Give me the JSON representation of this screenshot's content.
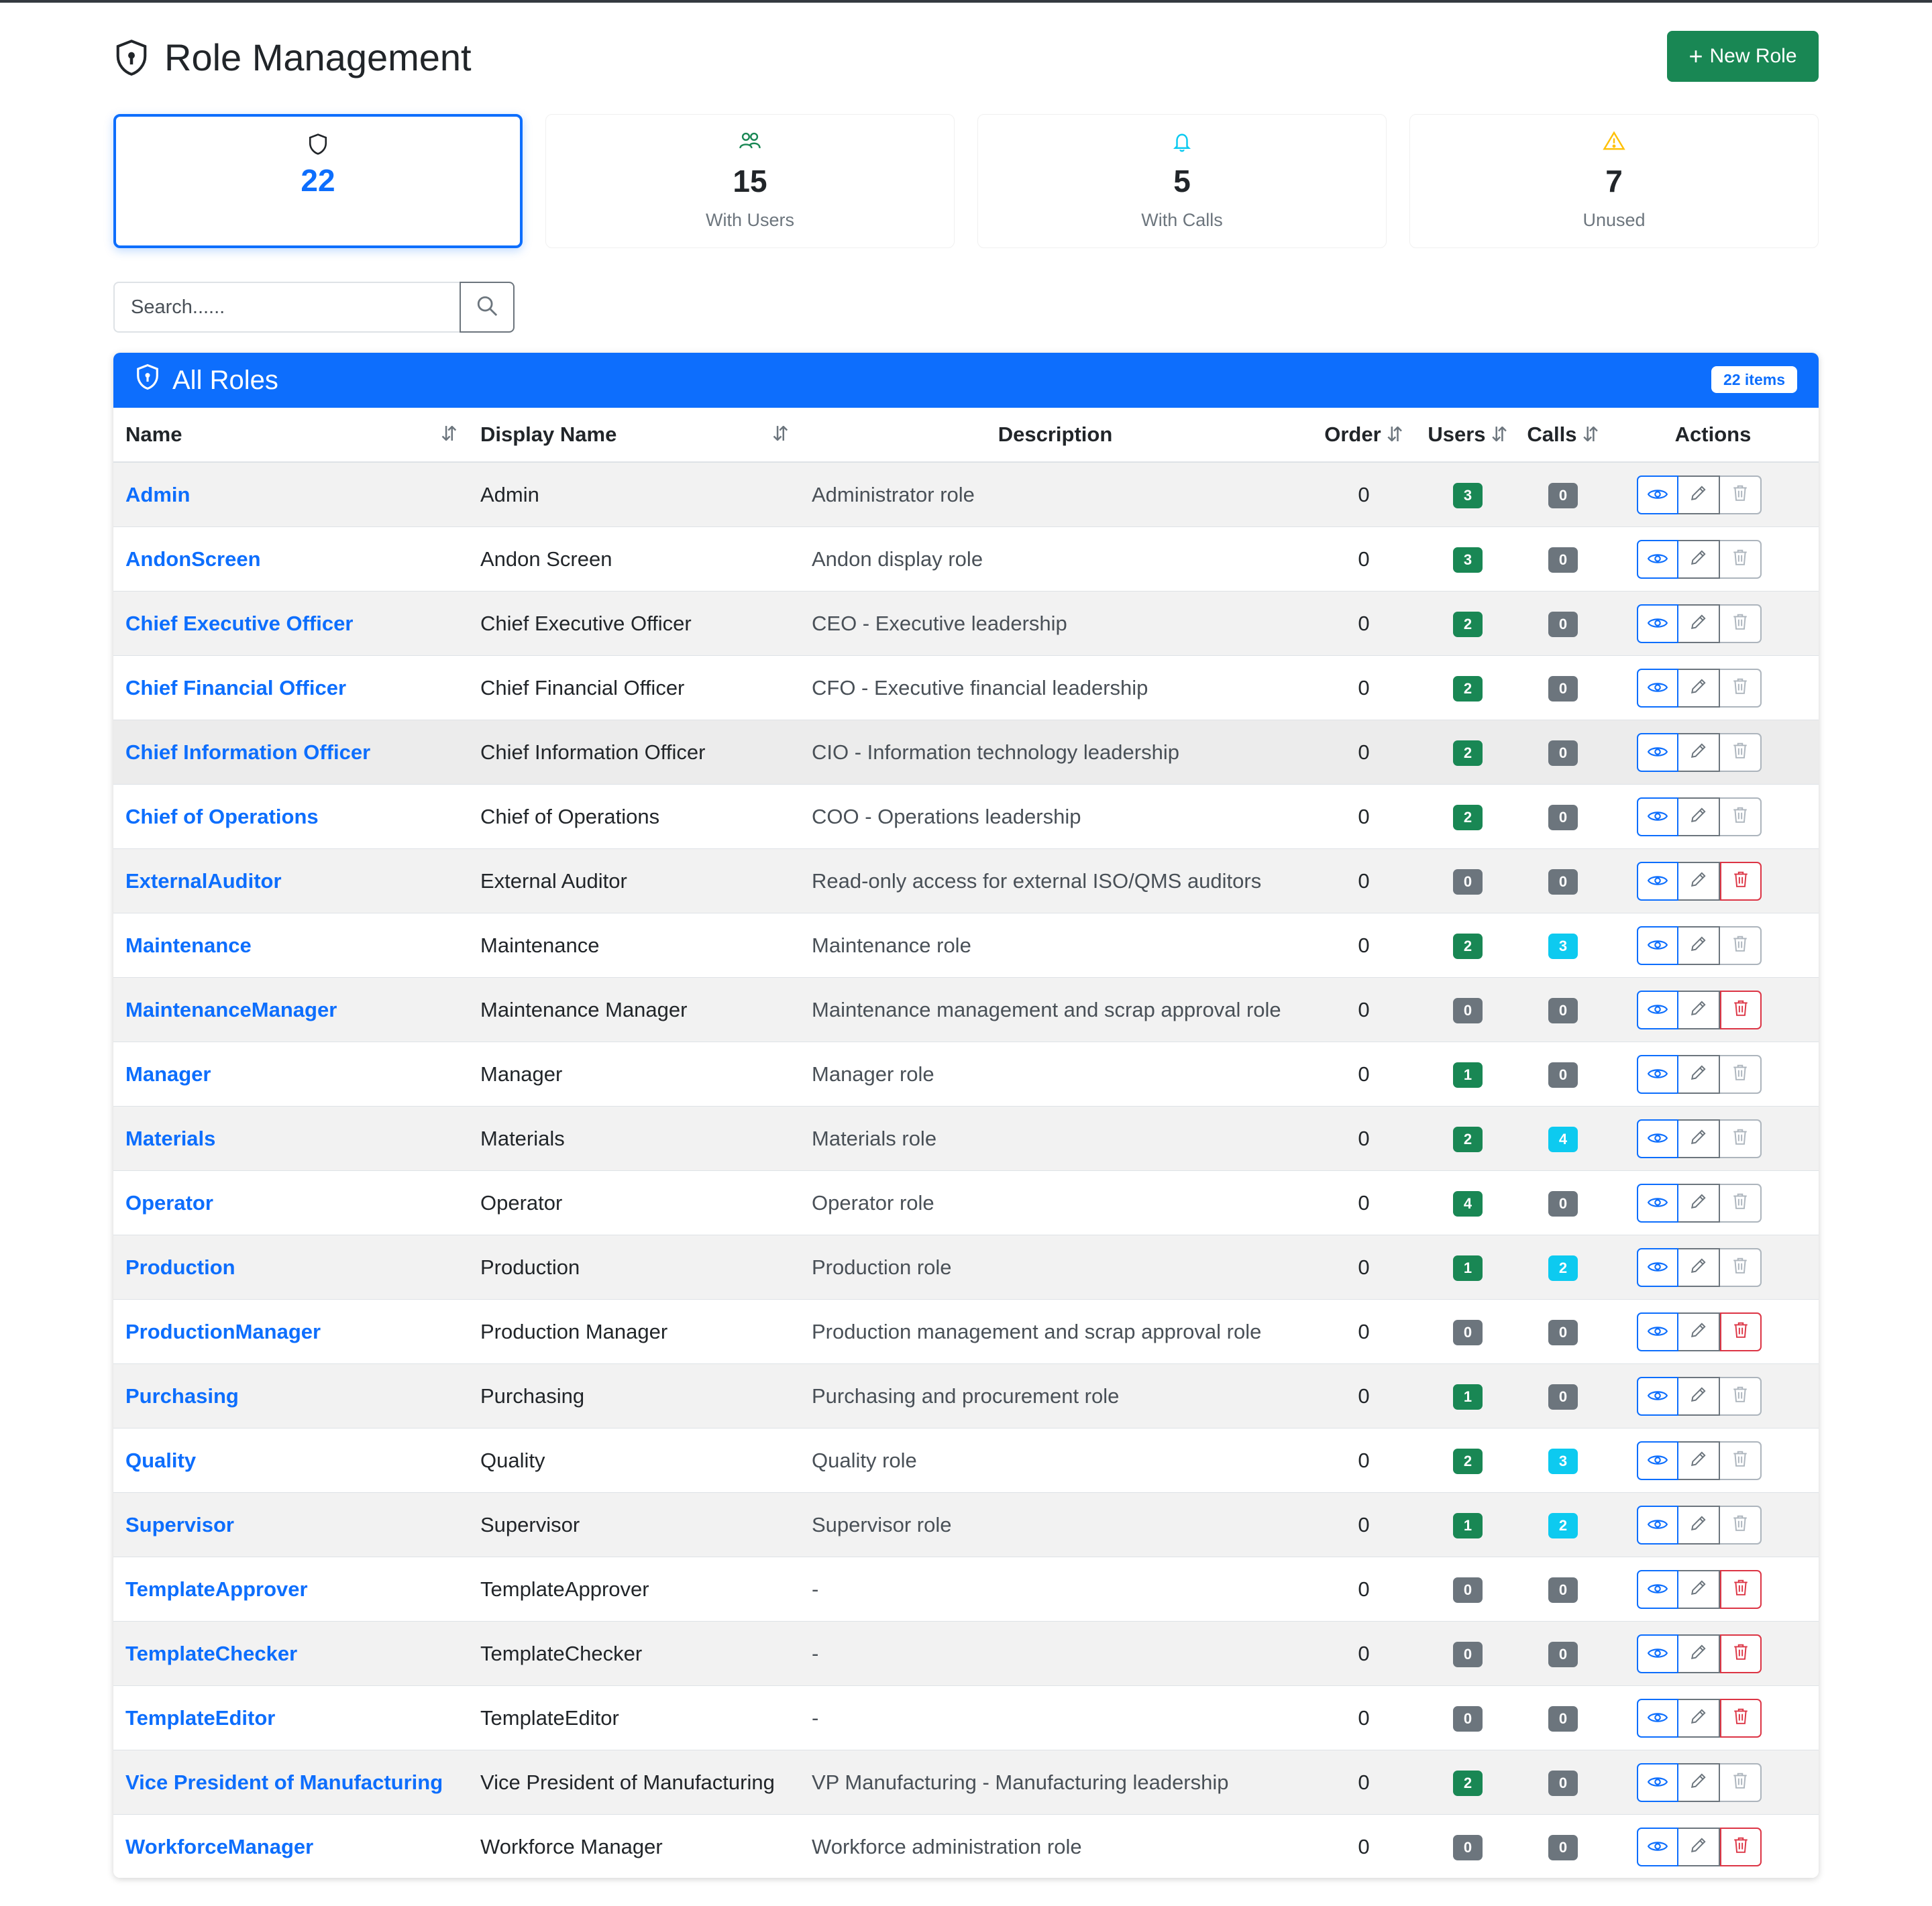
{
  "header": {
    "title": "Role Management",
    "new_role_label": "New Role"
  },
  "stats": [
    {
      "value": "22",
      "label": "",
      "icon": "shield-icon"
    },
    {
      "value": "15",
      "label": "With Users",
      "icon": "people-icon"
    },
    {
      "value": "5",
      "label": "With Calls",
      "icon": "bell-icon"
    },
    {
      "value": "7",
      "label": "Unused",
      "icon": "warning-triangle-icon"
    }
  ],
  "search": {
    "placeholder": "Search......",
    "value": ""
  },
  "panel": {
    "title": "All Roles",
    "count_label": "22 items"
  },
  "columns": {
    "name": "Name",
    "display_name": "Display Name",
    "description": "Description",
    "order": "Order",
    "users": "Users",
    "calls": "Calls",
    "actions": "Actions",
    "sort_glyph": "⇵"
  },
  "colors": {
    "primary": "#0d6efd",
    "success": "#198754",
    "secondary": "#6c757d",
    "info": "#0dcaf0",
    "danger": "#dc3545"
  },
  "roles": [
    {
      "name": "Admin",
      "display": "Admin",
      "desc": "Administrator role",
      "order": "0",
      "users": "3",
      "calls": "0",
      "deletable": false
    },
    {
      "name": "AndonScreen",
      "display": "Andon Screen",
      "desc": "Andon display role",
      "order": "0",
      "users": "3",
      "calls": "0",
      "deletable": false
    },
    {
      "name": "Chief Executive Officer",
      "display": "Chief Executive Officer",
      "desc": "CEO - Executive leadership",
      "order": "0",
      "users": "2",
      "calls": "0",
      "deletable": false
    },
    {
      "name": "Chief Financial Officer",
      "display": "Chief Financial Officer",
      "desc": "CFO - Executive financial leadership",
      "order": "0",
      "users": "2",
      "calls": "0",
      "deletable": false
    },
    {
      "name": "Chief Information Officer",
      "display": "Chief Information Officer",
      "desc": "CIO - Information technology leadership",
      "order": "0",
      "users": "2",
      "calls": "0",
      "deletable": false
    },
    {
      "name": "Chief of Operations",
      "display": "Chief of Operations",
      "desc": "COO - Operations leadership",
      "order": "0",
      "users": "2",
      "calls": "0",
      "deletable": false
    },
    {
      "name": "ExternalAuditor",
      "display": "External Auditor",
      "desc": "Read-only access for external ISO/QMS auditors",
      "order": "0",
      "users": "0",
      "calls": "0",
      "deletable": true
    },
    {
      "name": "Maintenance",
      "display": "Maintenance",
      "desc": "Maintenance role",
      "order": "0",
      "users": "2",
      "calls": "3",
      "deletable": false
    },
    {
      "name": "MaintenanceManager",
      "display": "Maintenance Manager",
      "desc": "Maintenance management and scrap approval role",
      "order": "0",
      "users": "0",
      "calls": "0",
      "deletable": true
    },
    {
      "name": "Manager",
      "display": "Manager",
      "desc": "Manager role",
      "order": "0",
      "users": "1",
      "calls": "0",
      "deletable": false
    },
    {
      "name": "Materials",
      "display": "Materials",
      "desc": "Materials role",
      "order": "0",
      "users": "2",
      "calls": "4",
      "deletable": false
    },
    {
      "name": "Operator",
      "display": "Operator",
      "desc": "Operator role",
      "order": "0",
      "users": "4",
      "calls": "0",
      "deletable": false
    },
    {
      "name": "Production",
      "display": "Production",
      "desc": "Production role",
      "order": "0",
      "users": "1",
      "calls": "2",
      "deletable": false
    },
    {
      "name": "ProductionManager",
      "display": "Production Manager",
      "desc": "Production management and scrap approval role",
      "order": "0",
      "users": "0",
      "calls": "0",
      "deletable": true
    },
    {
      "name": "Purchasing",
      "display": "Purchasing",
      "desc": "Purchasing and procurement role",
      "order": "0",
      "users": "1",
      "calls": "0",
      "deletable": false
    },
    {
      "name": "Quality",
      "display": "Quality",
      "desc": "Quality role",
      "order": "0",
      "users": "2",
      "calls": "3",
      "deletable": false
    },
    {
      "name": "Supervisor",
      "display": "Supervisor",
      "desc": "Supervisor role",
      "order": "0",
      "users": "1",
      "calls": "2",
      "deletable": false
    },
    {
      "name": "TemplateApprover",
      "display": "TemplateApprover",
      "desc": "-",
      "order": "0",
      "users": "0",
      "calls": "0",
      "deletable": true
    },
    {
      "name": "TemplateChecker",
      "display": "TemplateChecker",
      "desc": "-",
      "order": "0",
      "users": "0",
      "calls": "0",
      "deletable": true
    },
    {
      "name": "TemplateEditor",
      "display": "TemplateEditor",
      "desc": "-",
      "order": "0",
      "users": "0",
      "calls": "0",
      "deletable": true
    },
    {
      "name": "Vice President of Manufacturing",
      "display": "Vice President of Manufacturing",
      "desc": "VP Manufacturing - Manufacturing leadership",
      "order": "0",
      "users": "2",
      "calls": "0",
      "deletable": false
    },
    {
      "name": "WorkforceManager",
      "display": "Workforce Manager",
      "desc": "Workforce administration role",
      "order": "0",
      "users": "0",
      "calls": "0",
      "deletable": true
    }
  ]
}
